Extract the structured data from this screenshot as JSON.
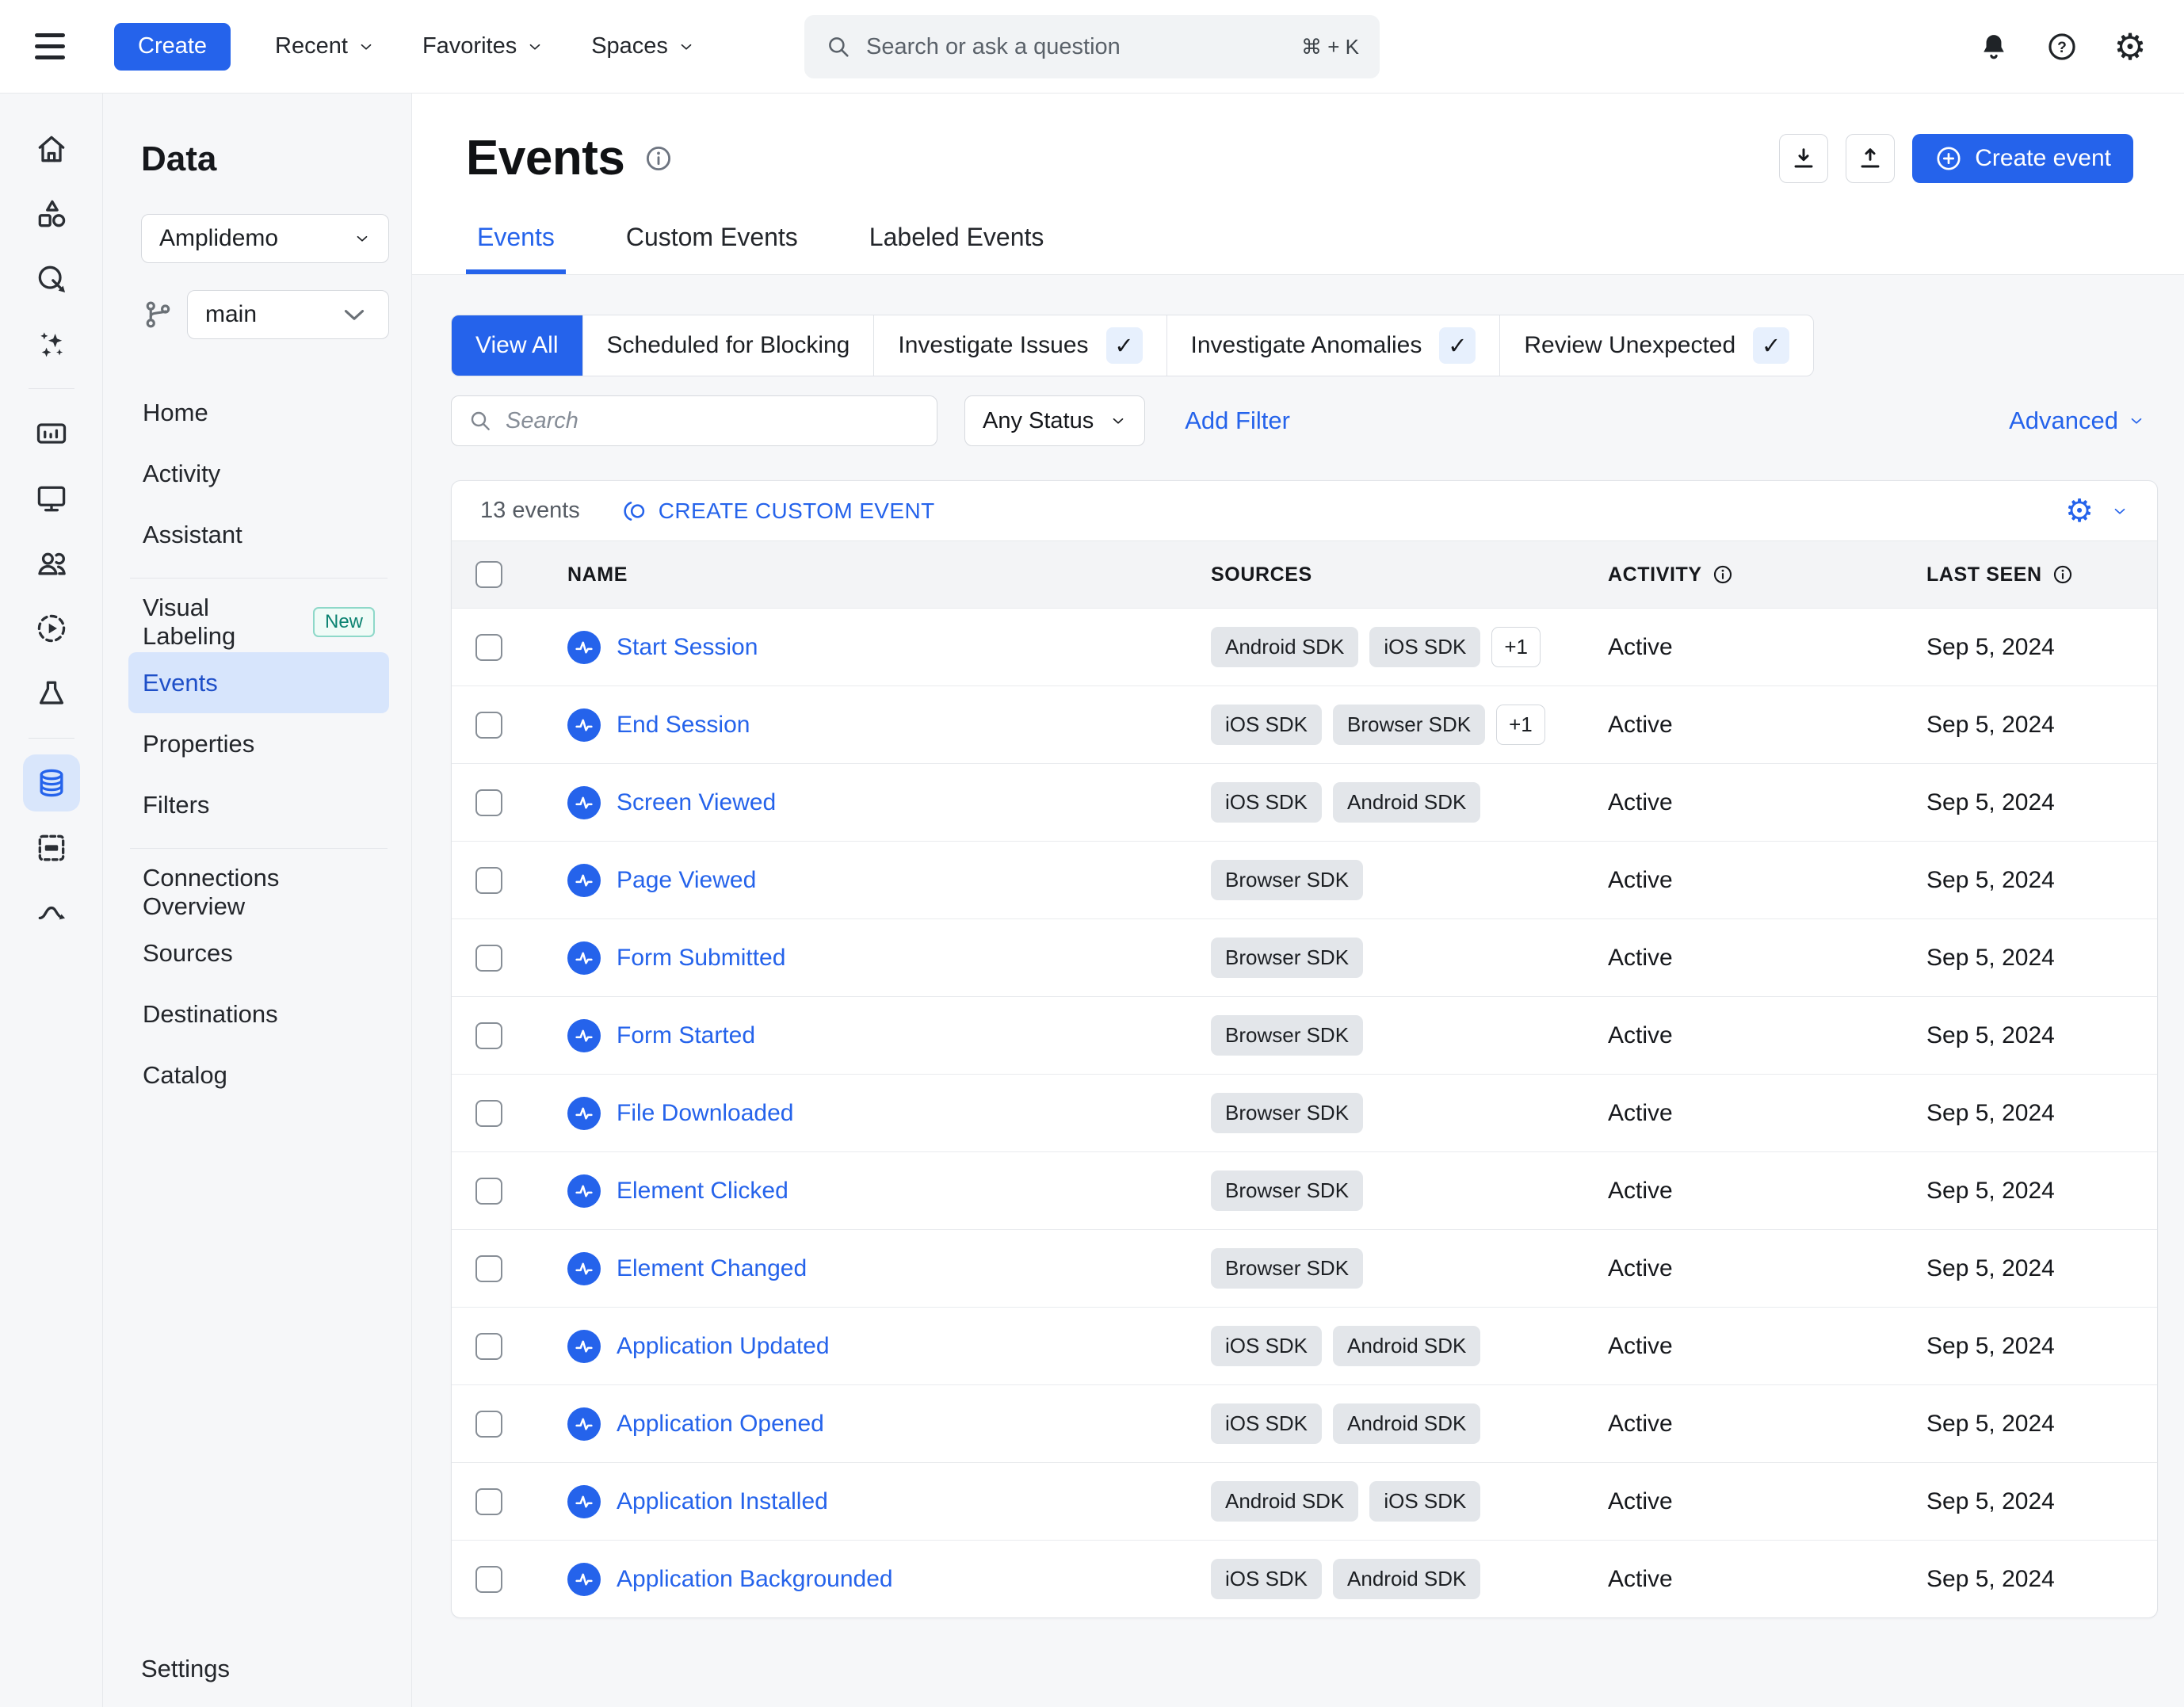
{
  "colors": {
    "accent": "#2563eb",
    "sidebar_selected_bg": "#d7e5fc",
    "sidebar_selected_text": "#1e4fc8",
    "page_bg": "#f6f7f9",
    "badge_bg": "#e3e6ea",
    "new_badge_teal": "#0c8271"
  },
  "icons": {
    "gear": "⚙"
  },
  "navbar": {
    "create_label": "Create",
    "menus": [
      {
        "label": "Recent"
      },
      {
        "label": "Favorites"
      },
      {
        "label": "Spaces"
      }
    ],
    "search_placeholder": "Search or ask a question",
    "search_shortcut": "⌘ + K"
  },
  "sidebar": {
    "title": "Data",
    "project": "Amplidemo",
    "branch": "main",
    "items": [
      {
        "label": "Home"
      },
      {
        "label": "Activity"
      },
      {
        "label": "Assistant"
      },
      {
        "label": "Visual Labeling",
        "badge": "New",
        "divider_before": true
      },
      {
        "label": "Events",
        "selected": true
      },
      {
        "label": "Properties"
      },
      {
        "label": "Filters"
      },
      {
        "label": "Connections Overview",
        "divider_before": true
      },
      {
        "label": "Sources"
      },
      {
        "label": "Destinations"
      },
      {
        "label": "Catalog"
      }
    ],
    "footer_item": "Settings"
  },
  "header": {
    "title": "Events",
    "create_button": "Create event",
    "tabs": [
      {
        "label": "Events",
        "active": true
      },
      {
        "label": "Custom Events"
      },
      {
        "label": "Labeled Events"
      }
    ]
  },
  "filters": {
    "chips": [
      {
        "label": "View All",
        "selected": true
      },
      {
        "label": "Scheduled for Blocking"
      },
      {
        "label": "Investigate Issues",
        "check": "✓"
      },
      {
        "label": "Investigate Anomalies",
        "check": "✓"
      },
      {
        "label": "Review Unexpected",
        "check": "✓"
      }
    ],
    "search_placeholder": "Search",
    "status_filter": "Any Status",
    "add_filter_label": "Add Filter",
    "advanced_label": "Advanced"
  },
  "table": {
    "count_label": "13 events",
    "create_custom_event_label": "CREATE CUSTOM EVENT",
    "columns": [
      {
        "label": "NAME",
        "pad": true
      },
      {
        "label": "SOURCES"
      },
      {
        "label": "ACTIVITY",
        "info": true
      },
      {
        "label": "LAST SEEN",
        "info": true
      }
    ],
    "rows": [
      {
        "name": "Start Session",
        "sources": [
          "Android SDK",
          "iOS SDK"
        ],
        "more": "+1",
        "activity": "Active",
        "last_seen": "Sep 5, 2024"
      },
      {
        "name": "End Session",
        "sources": [
          "iOS SDK",
          "Browser SDK"
        ],
        "more": "+1",
        "activity": "Active",
        "last_seen": "Sep 5, 2024"
      },
      {
        "name": "Screen Viewed",
        "sources": [
          "iOS SDK",
          "Android SDK"
        ],
        "activity": "Active",
        "last_seen": "Sep 5, 2024"
      },
      {
        "name": "Page Viewed",
        "sources": [
          "Browser SDK"
        ],
        "activity": "Active",
        "last_seen": "Sep 5, 2024"
      },
      {
        "name": "Form Submitted",
        "sources": [
          "Browser SDK"
        ],
        "activity": "Active",
        "last_seen": "Sep 5, 2024"
      },
      {
        "name": "Form Started",
        "sources": [
          "Browser SDK"
        ],
        "activity": "Active",
        "last_seen": "Sep 5, 2024"
      },
      {
        "name": "File Downloaded",
        "sources": [
          "Browser SDK"
        ],
        "activity": "Active",
        "last_seen": "Sep 5, 2024"
      },
      {
        "name": "Element Clicked",
        "sources": [
          "Browser SDK"
        ],
        "activity": "Active",
        "last_seen": "Sep 5, 2024"
      },
      {
        "name": "Element Changed",
        "sources": [
          "Browser SDK"
        ],
        "activity": "Active",
        "last_seen": "Sep 5, 2024"
      },
      {
        "name": "Application Updated",
        "sources": [
          "iOS SDK",
          "Android SDK"
        ],
        "activity": "Active",
        "last_seen": "Sep 5, 2024"
      },
      {
        "name": "Application Opened",
        "sources": [
          "iOS SDK",
          "Android SDK"
        ],
        "activity": "Active",
        "last_seen": "Sep 5, 2024"
      },
      {
        "name": "Application Installed",
        "sources": [
          "Android SDK",
          "iOS SDK"
        ],
        "activity": "Active",
        "last_seen": "Sep 5, 2024"
      },
      {
        "name": "Application Backgrounded",
        "sources": [
          "iOS SDK",
          "Android SDK"
        ],
        "activity": "Active",
        "last_seen": "Sep 5, 2024"
      }
    ]
  }
}
